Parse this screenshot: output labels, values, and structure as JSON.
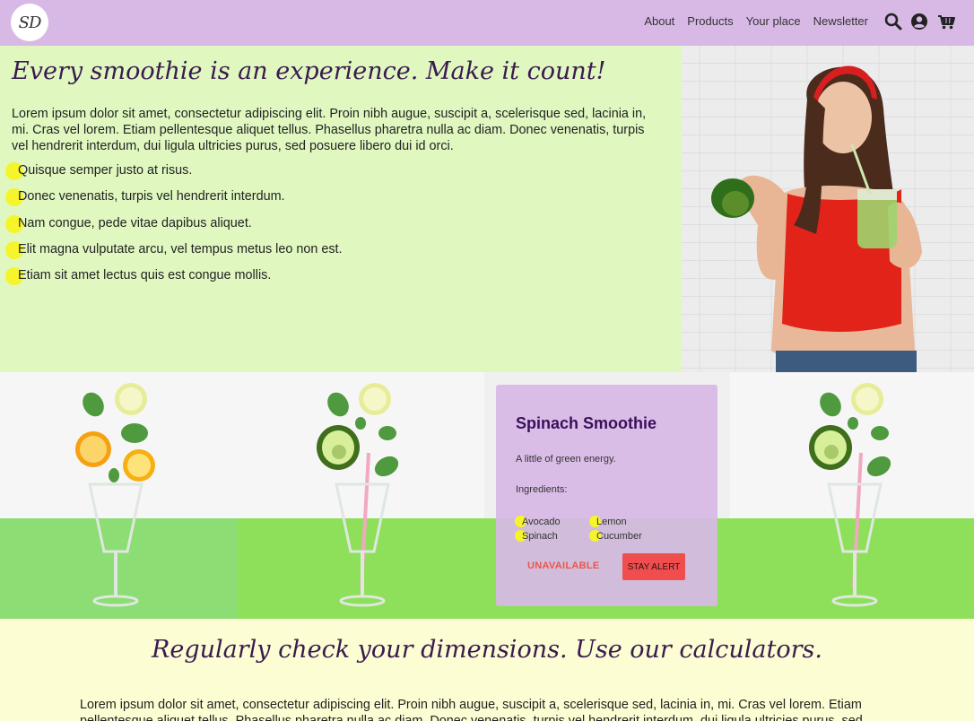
{
  "header": {
    "logo_text": "SD",
    "nav": [
      "About",
      "Products",
      "Your place",
      "Newsletter"
    ],
    "icons": [
      "search-icon",
      "user-icon",
      "cart-icon"
    ],
    "bg_color": "#d8b9e6"
  },
  "hero": {
    "title": "Every smoothie is an experience. Make it count!",
    "paragraph": "Lorem ipsum dolor sit amet, consectetur adipiscing elit. Proin nibh augue, suscipit a, scelerisque sed, lacinia in, mi. Cras vel lorem. Etiam pellentesque aliquet tellus. Phasellus pharetra nulla ac diam. Donec venenatis, turpis vel hendrerit interdum, dui ligula ultricies purus, sed posuere libero dui id orci.",
    "bullets": [
      "Quisque semper justo at risus.",
      "Donec venenatis, turpis vel hendrerit interdum.",
      "Nam congue, pede vitae dapibus aliquet.",
      "Elit magna vulputate arcu, vel tempus metus leo non est.",
      "Etiam sit amet lectus quis est congue mollis."
    ],
    "bg_color": "#e0f8c0",
    "bullet_color": "#f6f42a"
  },
  "product_card": {
    "title": "Spinach Smoothie",
    "description": "A little of green energy.",
    "ingredients_label": "Ingredients:",
    "ingredients": [
      "Avocado",
      "Lemon",
      "Spinach",
      "Cucumber"
    ],
    "unavailable_label": "UNAVAILABLE",
    "alert_label": "STAY ALERT",
    "accent_color": "#f04e4e"
  },
  "lower": {
    "title": "Regularly check your dimensions. Use our calculators.",
    "paragraph": "Lorem ipsum dolor sit amet, consectetur adipiscing elit. Proin nibh augue, suscipit a, scelerisque sed, lacinia in, mi. Cras vel lorem. Etiam pellentesque aliquet tellus. Phasellus pharetra nulla ac diam. Donec venenatis, turpis vel hendrerit interdum, dui ligula ultricies purus, sed",
    "bg_color": "#fcfdd2"
  }
}
